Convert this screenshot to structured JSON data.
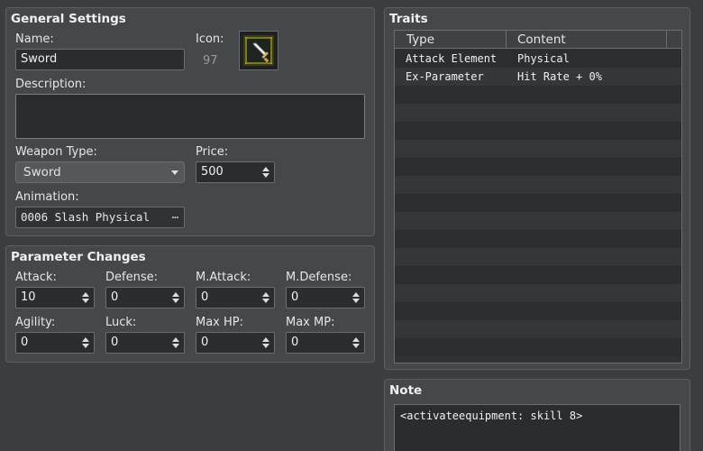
{
  "general": {
    "title": "General Settings",
    "name_label": "Name:",
    "name_value": "Sword",
    "icon_label": "Icon:",
    "icon_index": "97",
    "description_label": "Description:",
    "description_value": "",
    "weapon_type_label": "Weapon Type:",
    "weapon_type_value": "Sword",
    "price_label": "Price:",
    "price_value": "500",
    "animation_label": "Animation:",
    "animation_value": "0006 Slash Physical",
    "animation_button": "⋯"
  },
  "params": {
    "title": "Parameter Changes",
    "fields": [
      {
        "label": "Attack:",
        "value": "10"
      },
      {
        "label": "Defense:",
        "value": "0"
      },
      {
        "label": "M.Attack:",
        "value": "0"
      },
      {
        "label": "M.Defense:",
        "value": "0"
      },
      {
        "label": "Agility:",
        "value": "0"
      },
      {
        "label": "Luck:",
        "value": "0"
      },
      {
        "label": "Max HP:",
        "value": "0"
      },
      {
        "label": "Max MP:",
        "value": "0"
      }
    ]
  },
  "traits": {
    "title": "Traits",
    "columns": [
      "Type",
      "Content"
    ],
    "rows": [
      {
        "type": "Attack Element",
        "content": "Physical"
      },
      {
        "type": "Ex-Parameter",
        "content": "Hit Rate + 0%"
      }
    ]
  },
  "note": {
    "title": "Note",
    "value": "<activateequipment: skill 8>"
  },
  "colors": {
    "background": "#3b3e40",
    "panel": "#44484a",
    "field": "#2a2d2f",
    "icon_gold": "#bdb521"
  },
  "icons": {
    "weapon_icon": "sword-icon"
  }
}
